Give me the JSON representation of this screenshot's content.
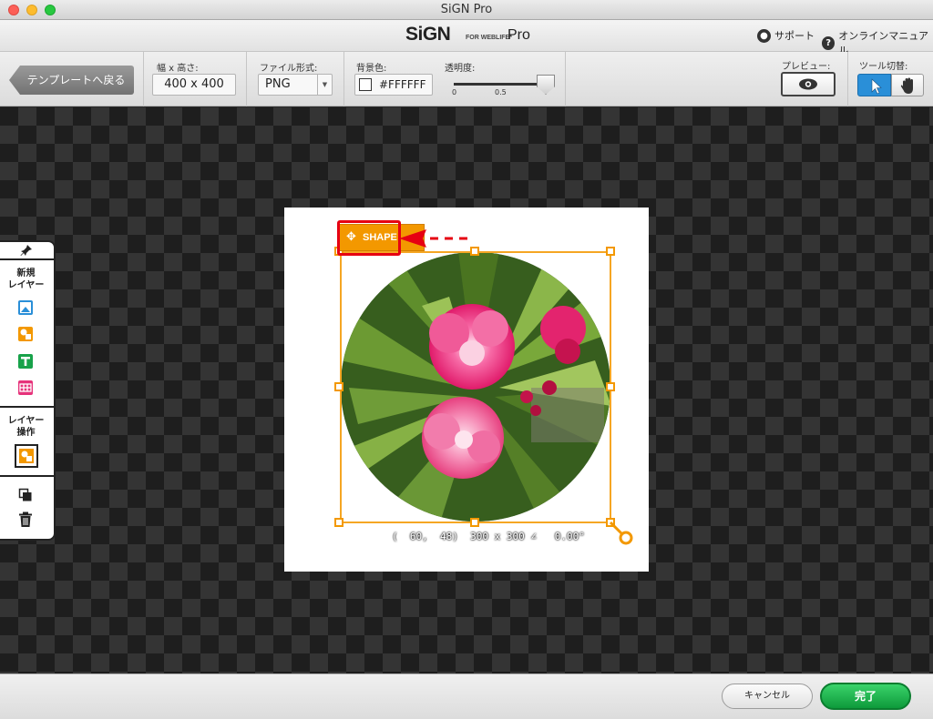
{
  "window": {
    "title": "SiGN Pro"
  },
  "header": {
    "logo": "SiGN",
    "logo_sub": "FOR WEBLIFE*",
    "logo_pro": "Pro",
    "support_label": "サポート",
    "manual_label": "オンラインマニュアル"
  },
  "toolbar": {
    "back_label": "テンプレートへ戻る",
    "size_label": "幅 x 高さ:",
    "size_value": "400 x 400",
    "format_label": "ファイル形式:",
    "format_value": "PNG",
    "bg_label": "背景色:",
    "bg_value": "#FFFFFF",
    "opacity_label": "透明度:",
    "opacity_min": "0",
    "opacity_mid": "0.5",
    "opacity_value": 1.0,
    "preview_label": "プレビュー:",
    "tool_label": "ツール切替:"
  },
  "left_panel": {
    "new_layer_label": "新規\nレイヤー",
    "layer_op_label": "レイヤー\n操作"
  },
  "canvas": {
    "shape_tag": "SHAPE",
    "readout": "(  60,  48)  300 x 300 ∠   0.00°"
  },
  "footer": {
    "cancel_label": "キャンセル",
    "done_label": "完了"
  },
  "colors": {
    "accent_orange": "#f39800",
    "selection_orange": "#f5a623",
    "annotation_red": "#e60012",
    "done_green": "#18b04a",
    "tool_active_blue": "#2a8fd8"
  }
}
